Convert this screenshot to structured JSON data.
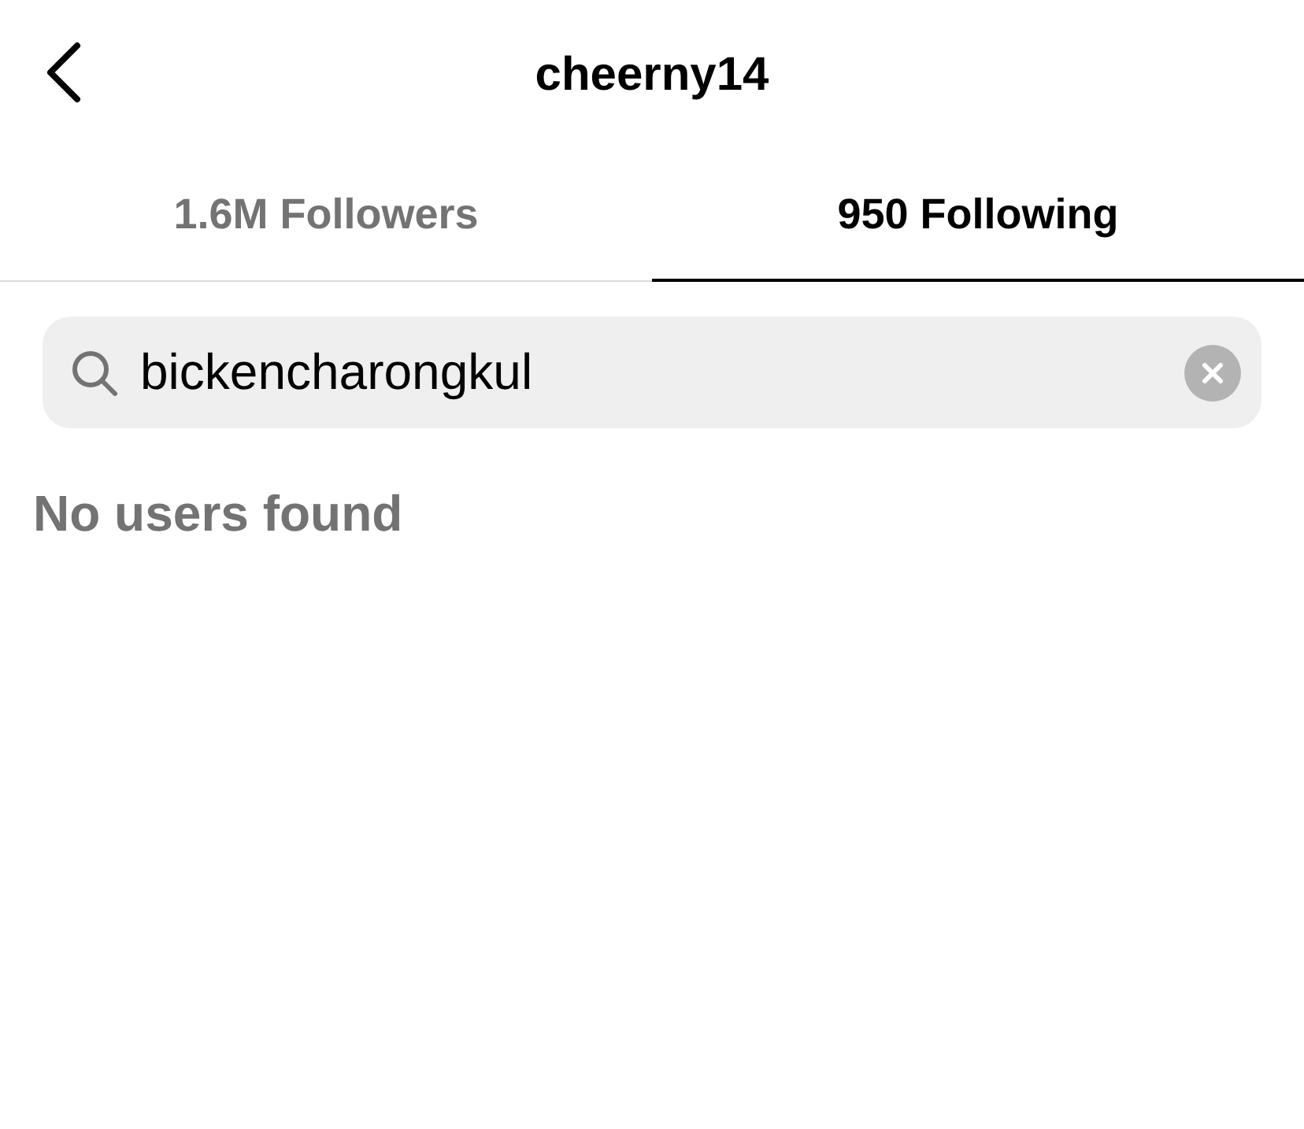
{
  "header": {
    "title": "cheerny14"
  },
  "tabs": [
    {
      "label": "1.6M Followers",
      "selected": false
    },
    {
      "label": "950 Following",
      "selected": true
    }
  ],
  "search": {
    "value": "bickencharongkul"
  },
  "empty_message": "No users found"
}
